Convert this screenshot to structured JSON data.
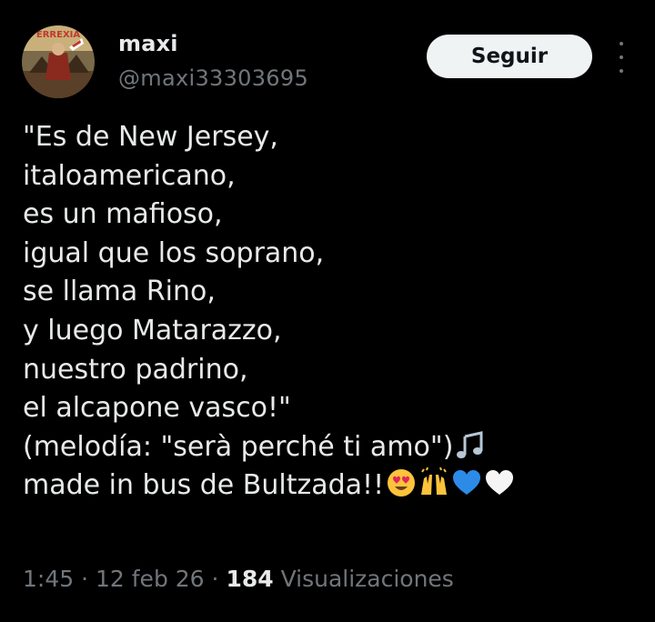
{
  "author": {
    "display_name": "maxi",
    "handle": "@maxi33303695",
    "avatar_text": "ERREXIA"
  },
  "follow_button": {
    "label": "Seguir"
  },
  "more_button": {
    "icon": "more-vertical-icon"
  },
  "tweet": {
    "lines": [
      "\"Es de New Jersey,",
      "italoamericano,",
      "es un mafioso,",
      "igual que los soprano,",
      "se llama Rino,",
      "y luego Matarazzo,",
      "nuestro padrino,",
      "el alcapone vasco!\"",
      "(melodía: \"serà perché ti amo\")",
      "made in bus de Bultzada!!"
    ],
    "emojis": {
      "line9": [
        "musical-notes-icon"
      ],
      "line10": [
        "heart-eyes-emoji",
        "raising-hands-emoji",
        "blue-heart-emoji",
        "white-heart-emoji"
      ]
    }
  },
  "meta": {
    "time": "1:45",
    "separator": "·",
    "date": "12 feb 26",
    "views_count": "184",
    "views_label": "Visualizaciones"
  },
  "colors": {
    "background": "#000000",
    "text": "#e7e9ea",
    "secondary": "#71767b",
    "button_bg": "#eff3f4",
    "button_text": "#0f1419"
  }
}
